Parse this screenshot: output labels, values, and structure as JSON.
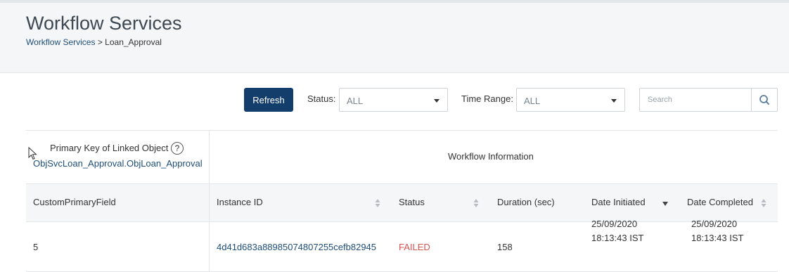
{
  "header": {
    "title": "Workflow Services",
    "breadcrumb": {
      "link": "Workflow Services",
      "separator": ">",
      "current": "Loan_Approval"
    }
  },
  "toolbar": {
    "refresh_label": "Refresh",
    "status_label": "Status:",
    "status_value": "ALL",
    "time_range_label": "Time Range:",
    "time_range_value": "ALL",
    "search_placeholder": "Search"
  },
  "grid": {
    "primary_key_title": "Primary Key of Linked Object",
    "primary_key_link": "ObjSvcLoan_Approval.ObjLoan_Approval",
    "workflow_info_title": "Workflow Information",
    "columns": [
      "CustomPrimaryField",
      "Instance ID",
      "Status",
      "Duration (sec)",
      "Date Initiated",
      "Date Completed"
    ],
    "rows": [
      {
        "custom_primary_field": "5",
        "instance_id": "4d41d683a88985074807255cefb82945",
        "status": "FAILED",
        "duration": "158",
        "date_initiated": "25/09/2020",
        "time_initiated": "18:13:43 IST",
        "date_completed": "25/09/2020",
        "time_completed": "18:13:43 IST"
      }
    ]
  },
  "colors": {
    "primary_button": "#133e6c",
    "link": "#1e4e79",
    "failed": "#d9534f"
  },
  "icons": [
    "help-icon",
    "search-icon",
    "chevron-down-icon",
    "sort-icon",
    "sort-desc-icon",
    "mouse-cursor-icon"
  ]
}
